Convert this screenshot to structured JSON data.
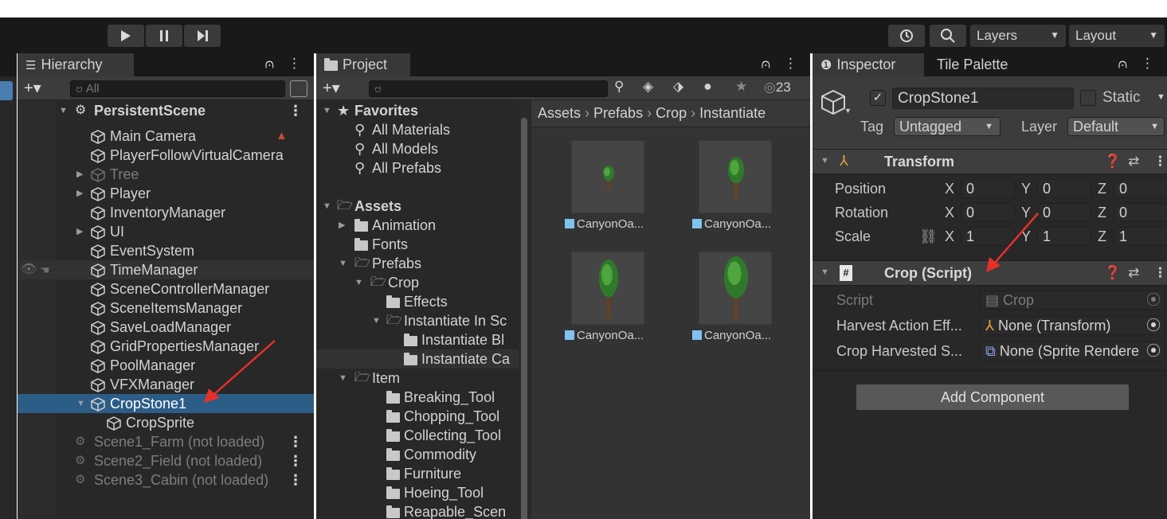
{
  "toolbar": {
    "layers_label": "Layers",
    "layout_label": "Layout"
  },
  "hierarchy": {
    "tab_label": "Hierarchy",
    "search_placeholder": "All",
    "rows": [
      {
        "label": "PersistentScene"
      },
      {
        "label": "Main Camera"
      },
      {
        "label": "PlayerFollowVirtualCamera"
      },
      {
        "label": "Tree"
      },
      {
        "label": "Player"
      },
      {
        "label": "InventoryManager"
      },
      {
        "label": "UI"
      },
      {
        "label": "EventSystem"
      },
      {
        "label": "TimeManager"
      },
      {
        "label": "SceneControllerManager"
      },
      {
        "label": "SceneItemsManager"
      },
      {
        "label": "SaveLoadManager"
      },
      {
        "label": "GridPropertiesManager"
      },
      {
        "label": "PoolManager"
      },
      {
        "label": "VFXManager"
      },
      {
        "label": "CropStone1"
      },
      {
        "label": "CropSprite"
      },
      {
        "label": "Scene1_Farm (not loaded)"
      },
      {
        "label": "Scene2_Field (not loaded)"
      },
      {
        "label": "Scene3_Cabin (not loaded)"
      }
    ]
  },
  "project": {
    "tab_label": "Project",
    "hidden_count": "23",
    "breadcrumb": [
      "Assets",
      "Prefabs",
      "Crop",
      "Instantiate"
    ],
    "tree": [
      {
        "label": "Favorites"
      },
      {
        "label": "All Materials"
      },
      {
        "label": "All Models"
      },
      {
        "label": "All Prefabs"
      },
      {
        "label": "Assets"
      },
      {
        "label": "Animation"
      },
      {
        "label": "Fonts"
      },
      {
        "label": "Prefabs"
      },
      {
        "label": "Crop"
      },
      {
        "label": "Effects"
      },
      {
        "label": "Instantiate In Sc"
      },
      {
        "label": "Instantiate Bl"
      },
      {
        "label": "Instantiate Ca"
      },
      {
        "label": "Item"
      },
      {
        "label": "Breaking_Tool"
      },
      {
        "label": "Chopping_Tool"
      },
      {
        "label": "Collecting_Tool"
      },
      {
        "label": "Commodity"
      },
      {
        "label": "Furniture"
      },
      {
        "label": "Hoeing_Tool"
      },
      {
        "label": "Reapable_Scen"
      }
    ],
    "assets": [
      {
        "label": "CanyonOa..."
      },
      {
        "label": "CanyonOa..."
      },
      {
        "label": "CanyonOa..."
      },
      {
        "label": "CanyonOa..."
      }
    ]
  },
  "inspector": {
    "tab_label": "Inspector",
    "tab2_label": "Tile Palette",
    "object_name": "CropStone1",
    "static_label": "Static",
    "tag_label": "Tag",
    "tag_value": "Untagged",
    "layer_label": "Layer",
    "layer_value": "Default",
    "transform": {
      "title": "Transform",
      "position_label": "Position",
      "rotation_label": "Rotation",
      "scale_label": "Scale",
      "x": "X",
      "y": "Y",
      "z": "Z",
      "position": [
        "0",
        "0",
        "0"
      ],
      "rotation": [
        "0",
        "0",
        "0"
      ],
      "scale": [
        "1",
        "1",
        "1"
      ]
    },
    "crop": {
      "title": "Crop (Script)",
      "script_label": "Script",
      "script_value": "Crop",
      "harvest_label": "Harvest Action Eff...",
      "harvest_value": "None (Transform)",
      "sprite_label": "Crop Harvested S...",
      "sprite_value": "None (Sprite Rendere"
    },
    "add_component": "Add Component"
  },
  "colors": {
    "selection": "#2c5d87",
    "arrow": "#e8302a"
  }
}
